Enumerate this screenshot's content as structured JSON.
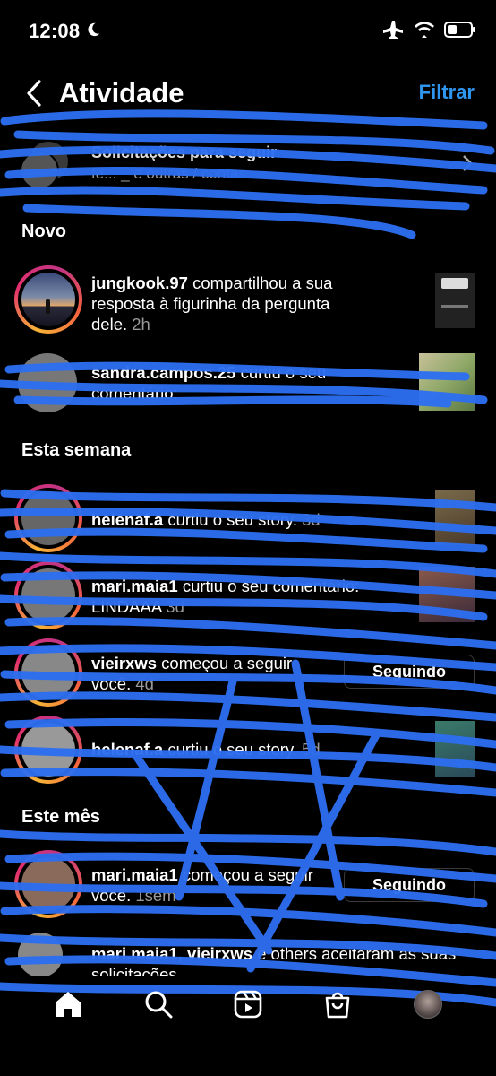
{
  "status_bar": {
    "time": "12:08"
  },
  "header": {
    "title": "Atividade",
    "filter_label": "Filtrar"
  },
  "requests": {
    "title": "Solicitações para seguir",
    "subtitle": "fe... _ e outras / contas"
  },
  "sections": {
    "new": "Novo",
    "this_week": "Esta semana",
    "this_month": "Este mês"
  },
  "items": [
    {
      "user": "jungkook.97",
      "text": " compartilhou a sua resposta à figurinha da pergunta dele.",
      "time": "2h"
    },
    {
      "user": "sandra.campos.25",
      "text": " curtiu o seu comentário:",
      "time": ""
    },
    {
      "user": "helenaf.a",
      "text": " curtiu o seu story.",
      "time": "3d"
    },
    {
      "user": "mari.maia1",
      "text": " curtiu o seu comentário: LINDAAA",
      "time": "3d"
    },
    {
      "user": "vieirxws",
      "text": " começou a seguir você.",
      "time": "4d",
      "button": "Seguindo"
    },
    {
      "user": "helenaf.a",
      "text": " curtiu o seu story.",
      "time": "5d"
    },
    {
      "user": "mari.maia1",
      "text": " começou a seguir você.",
      "time": "1sem",
      "button": "Seguindo"
    },
    {
      "user": "mari.maia1, vieirxws",
      "text": " e others aceitaram as suas solicitações",
      "time": ""
    }
  ],
  "scribble_color": "#2d6ef0"
}
